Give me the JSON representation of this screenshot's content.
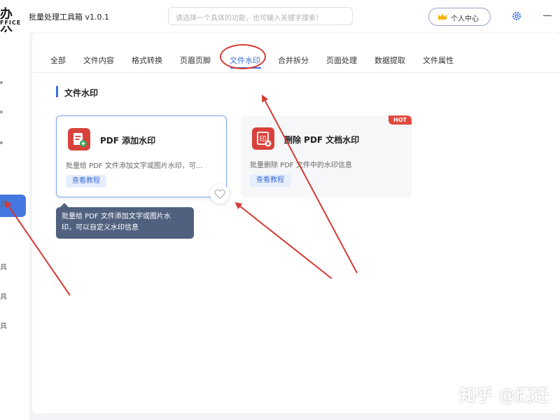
{
  "app": {
    "logo_main": "办公",
    "logo_sub": "FFICE",
    "title": "批量处理工具箱 v1.0.1"
  },
  "search": {
    "placeholder": "请选择一个具体的功能，也可输入关键字搜索！"
  },
  "header": {
    "user_center_label": "个人中心",
    "icons": [
      "crown-icon",
      "gear-icon",
      "minimize-icon"
    ]
  },
  "sidebar": {
    "fragments": [
      ".",
      "具",
      "具",
      "具",
      "具"
    ]
  },
  "tabs": [
    {
      "label": "全部"
    },
    {
      "label": "文件内容"
    },
    {
      "label": "格式转换"
    },
    {
      "label": "页眉页脚"
    },
    {
      "label": "文件水印",
      "active": true
    },
    {
      "label": "合并拆分"
    },
    {
      "label": "页面处理"
    },
    {
      "label": "数据提取"
    },
    {
      "label": "文件属性"
    }
  ],
  "section": {
    "title": "文件水印"
  },
  "cards": [
    {
      "title": "PDF 添加水印",
      "description": "批量给 PDF 文件添加文字或图片水印，可...",
      "link": "查看教程",
      "icon": "pdf-add-watermark-icon"
    },
    {
      "title": "删除 PDF 文档水印",
      "description": "批量删除 PDF 文件中的水印信息",
      "link": "查看教程",
      "badge": "HOT",
      "icon": "pdf-remove-watermark-icon"
    }
  ],
  "tooltip": {
    "line1": "批量给 PDF 文件添加文字或图片水",
    "line2": "印，可以自定义水印信息"
  },
  "watermark": "知乎 @鹰迁",
  "colors": {
    "accent": "#3a6fd8",
    "annotation": "#d63a33",
    "icon_red": "#d9423c",
    "tooltip_bg": "#50617f"
  }
}
